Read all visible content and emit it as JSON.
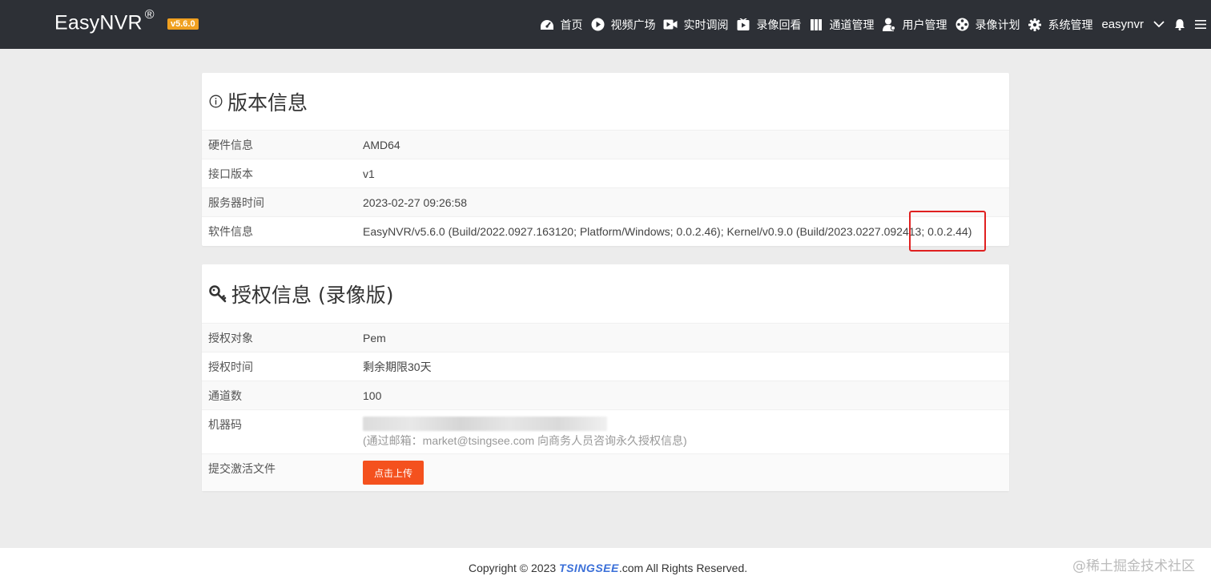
{
  "header": {
    "brand": "EasyNVR",
    "brand_mark": "®",
    "version": "v5.6.0",
    "nav": [
      {
        "label": "首页",
        "icon": "dashboard-icon"
      },
      {
        "label": "视频广场",
        "icon": "play-circle-icon"
      },
      {
        "label": "实时调阅",
        "icon": "video-camera-icon"
      },
      {
        "label": "录像回看",
        "icon": "play-box-icon"
      },
      {
        "label": "通道管理",
        "icon": "columns-icon"
      },
      {
        "label": "用户管理",
        "icon": "user-icon"
      },
      {
        "label": "录像计划",
        "icon": "film-reel-icon"
      },
      {
        "label": "系统管理",
        "icon": "gear-icon"
      }
    ],
    "user": "easynvr"
  },
  "version_panel": {
    "title": "版本信息",
    "rows": [
      {
        "label": "硬件信息",
        "value": "AMD64"
      },
      {
        "label": "接口版本",
        "value": "v1"
      },
      {
        "label": "服务器时间",
        "value": "2023-02-27 09:26:58"
      },
      {
        "label": "软件信息",
        "value": "EasyNVR/v5.6.0 (Build/2022.0927.163120; Platform/Windows; 0.0.2.46); Kernel/v0.9.0 (Build/2023.0227.092413; 0.0.2.44)"
      }
    ]
  },
  "license_panel": {
    "title": "授权信息 (录像版)",
    "rows": [
      {
        "label": "授权对象",
        "value": "Pem"
      },
      {
        "label": "授权时间",
        "value": "剩余期限30天"
      },
      {
        "label": "通道数",
        "value": "100"
      }
    ],
    "machine_code_label": "机器码",
    "machine_code_hint": "(通过邮箱：market@tsingsee.com 向商务人员咨询永久授权信息)",
    "upload_label": "提交激活文件",
    "upload_button": "点击上传"
  },
  "footer": {
    "copyright_prefix": "Copyright © 2023 ",
    "brand": "TSINGSEE",
    "copyright_suffix": ".com All Rights Reserved.",
    "watermark": "@稀土掘金技术社区"
  },
  "colors": {
    "header_bg": "#2d3036",
    "badge": "#f0a020",
    "upload_button": "#f4511e",
    "highlight_box": "#e02020"
  }
}
